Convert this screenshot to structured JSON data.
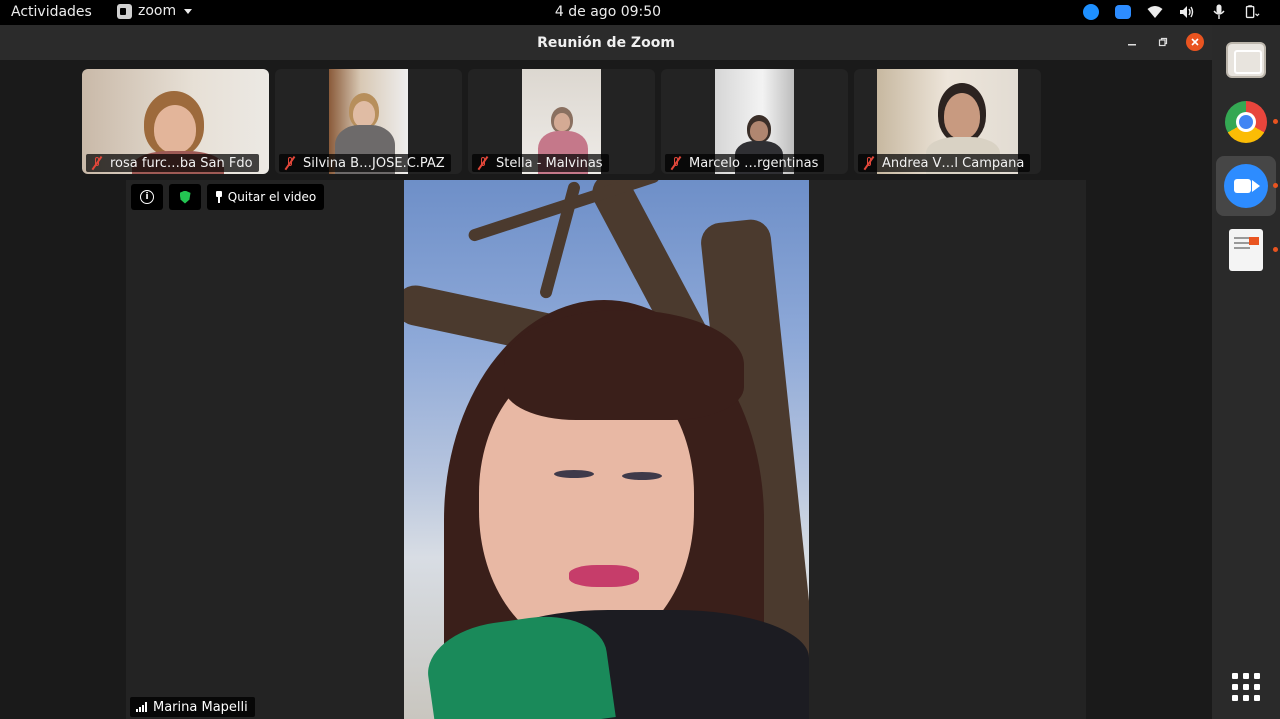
{
  "topbar": {
    "activities": "Actividades",
    "app_name": "zoom",
    "clock": "4 de ago  09:50",
    "tray_icons": [
      "teamviewer-icon",
      "zoom-icon",
      "wifi-icon",
      "volume-icon",
      "microphone-icon",
      "battery-icon"
    ]
  },
  "window": {
    "title": "Reunión de Zoom",
    "buttons": [
      "minimize-icon",
      "maximize-icon",
      "close-icon"
    ]
  },
  "participants": [
    {
      "name": "rosa furc…ba San Fdo",
      "muted": true
    },
    {
      "name": "Silvina B…JOSE.C.PAZ",
      "muted": true
    },
    {
      "name": "Stella - Malvinas",
      "muted": true
    },
    {
      "name": "Marcelo …rgentinas",
      "muted": true
    },
    {
      "name": "Andrea V…l Campana",
      "muted": true
    }
  ],
  "main_video": {
    "unpin_label": "Quitar el video",
    "speaker_name": "Marina Mapelli"
  },
  "dock": {
    "apps": [
      "files-icon",
      "chrome-icon",
      "zoom-icon",
      "document-viewer-icon",
      "show-applications-icon"
    ]
  },
  "colors": {
    "accent_close": "#e95420",
    "zoom_blue": "#2d8cff",
    "mute_red": "#e2473a",
    "shield_green": "#23c552"
  }
}
